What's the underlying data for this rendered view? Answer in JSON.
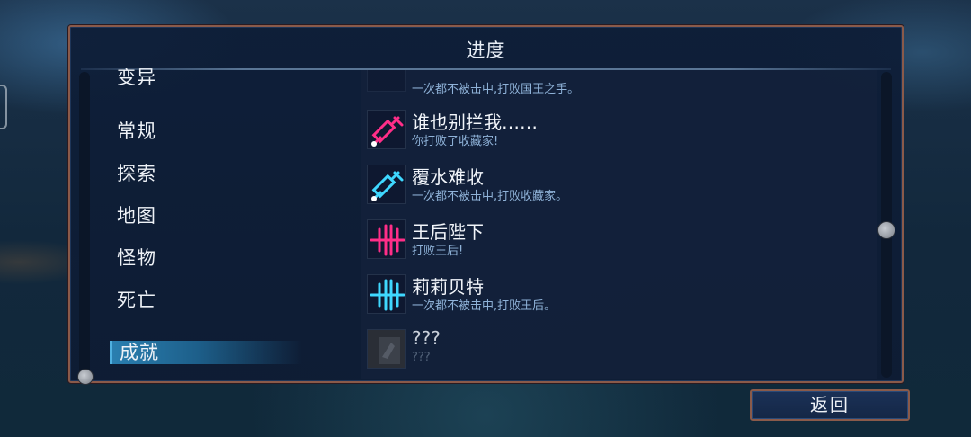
{
  "panel": {
    "title": "进度"
  },
  "categories": [
    {
      "label": "变异",
      "selected": false
    },
    {
      "label": "常规",
      "selected": false
    },
    {
      "label": "探索",
      "selected": false
    },
    {
      "label": "地图",
      "selected": false
    },
    {
      "label": "怪物",
      "selected": false
    },
    {
      "label": "死亡",
      "selected": false
    },
    {
      "label": "成就",
      "selected": true
    }
  ],
  "achievements": [
    {
      "name": "",
      "desc": "一次都不被击中,打败国王之手。",
      "icon": "partial-icon",
      "locked": false
    },
    {
      "name": "谁也别拦我……",
      "desc": "你打败了收藏家!",
      "icon": "syringe-icon",
      "color": "#ff2e88",
      "locked": false
    },
    {
      "name": "覆水难收",
      "desc": "一次都不被击中,打败收藏家。",
      "icon": "syringe-icon",
      "color": "#3fd8ff",
      "locked": false
    },
    {
      "name": "王后陛下",
      "desc": "打败王后!",
      "icon": "blades-icon",
      "color": "#ff2e88",
      "locked": false
    },
    {
      "name": "莉莉贝特",
      "desc": "一次都不被击中,打败王后。",
      "icon": "blades-icon",
      "color": "#3fd8ff",
      "locked": false
    },
    {
      "name": "???",
      "desc": "???",
      "icon": "locked-icon",
      "locked": true
    }
  ],
  "footer": {
    "back_label": "返回"
  }
}
